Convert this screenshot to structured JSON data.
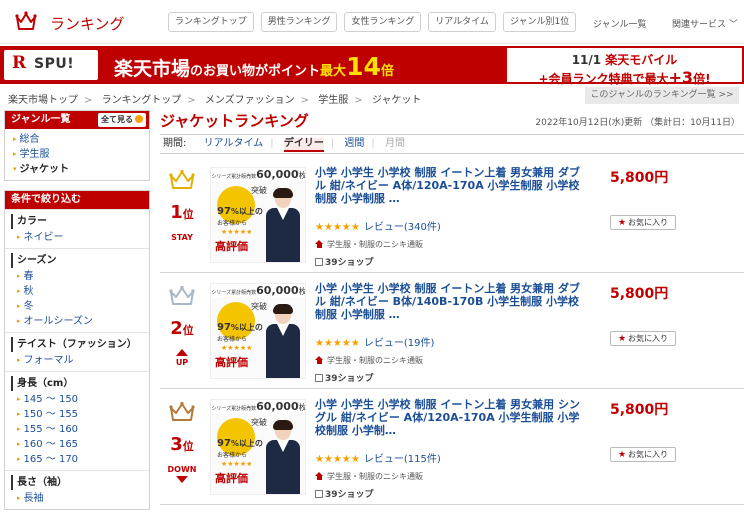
{
  "header": {
    "logo_text": "ランキング",
    "nav": [
      "ランキングトップ",
      "男性ランキング",
      "女性ランキング",
      "リアルタイム",
      "ジャンル別1位"
    ],
    "genre_list": "ジャンル一覧",
    "related_services": "関連サービス ﹀"
  },
  "banner": {
    "spu_r": "R",
    "spu_text": "SPU!",
    "main_a": "楽天市場",
    "main_b": "のお買い物",
    "main_c": "がポイント",
    "main_d": "最大",
    "main_pct": "14",
    "main_e": "倍",
    "right_line1_a": "11/1 ",
    "right_line1_b": "楽天モバイル",
    "right_line2_a": "+会員ランク特典で最大",
    "right_line2_b": "+3",
    "right_line2_c": "倍!"
  },
  "breadcrumb": [
    "楽天市場トップ",
    "ランキングトップ",
    "メンズファッション",
    "学生服",
    "ジャケット"
  ],
  "genre_ranking_link": "このジャンルのランキング一覧 >>",
  "sidebar": {
    "genre_title": "ジャンル一覧",
    "see_all": "全て見る",
    "genres": [
      "総合",
      "学生服",
      "ジャケット"
    ],
    "filter_title": "条件で絞り込む",
    "filters": [
      {
        "heading": "カラー",
        "items": [
          "ネイビー"
        ]
      },
      {
        "heading": "シーズン",
        "items": [
          "春",
          "秋",
          "冬",
          "オールシーズン"
        ]
      },
      {
        "heading": "テイスト（ファッション）",
        "items": [
          "フォーマル"
        ]
      },
      {
        "heading": "身長（cm）",
        "items": [
          "145 ～ 150",
          "150 ～ 155",
          "155 ～ 160",
          "160 ～ 165",
          "165 ～ 170"
        ]
      },
      {
        "heading": "長さ（袖）",
        "items": [
          "長袖"
        ]
      }
    ]
  },
  "main": {
    "title": "ジャケットランキング",
    "updated": "2022年10月12日(水)更新 （集計日：10月11日）",
    "period_label": "期間:",
    "periods": [
      "リアルタイム",
      "デイリー",
      "週間",
      "月間"
    ],
    "fav_label": "お気に入り",
    "review_label": "レビュー",
    "thumb_top_a": "シリーズ累計販売数",
    "thumb_top_n": "60,000",
    "thumb_top_b": "枚突破",
    "thumb_97": "97",
    "thumb_pct": "%以上の",
    "thumb_guest": "お客様から",
    "thumb_stars": "★★★★★",
    "thumb_high": "高評価",
    "items": [
      {
        "rank": "1",
        "rank_unit": "位",
        "trend": "STAY",
        "crown_color": "#e2b100",
        "name": "小学 小学生 小学校 制服 イートン上着 男女兼用 ダブル 紺/ネイビー A体/120A-170A 小学生制服 小学校制服 小学制服 …",
        "price": "5,800円",
        "stars": "★★★★★",
        "reviews": "(340件)",
        "shop": "学生服・制服のニシキ通販",
        "shops": "39ショップ"
      },
      {
        "rank": "2",
        "rank_unit": "位",
        "trend": "UP",
        "crown_color": "#a8b6c6",
        "name": "小学 小学生 小学校 制服 イートン上着 男女兼用 ダブル 紺/ネイビー B体/140B-170B 小学生制服 小学校制服 小学制服 …",
        "price": "5,800円",
        "stars": "★★★★★",
        "reviews": "(19件)",
        "shop": "学生服・制服のニシキ通販",
        "shops": "39ショップ"
      },
      {
        "rank": "3",
        "rank_unit": "位",
        "trend": "DOWN",
        "crown_color": "#b4793a",
        "name": "小学 小学生 小学校 制服 イートン上着 男女兼用 シングル 紺/ネイビー A体/120A-170A 小学生制服 小学校制服 小学制…",
        "price": "5,800円",
        "stars": "★★★★★",
        "reviews": "(115件)",
        "shop": "学生服・制服のニシキ通販",
        "shops": "39ショップ"
      }
    ]
  }
}
